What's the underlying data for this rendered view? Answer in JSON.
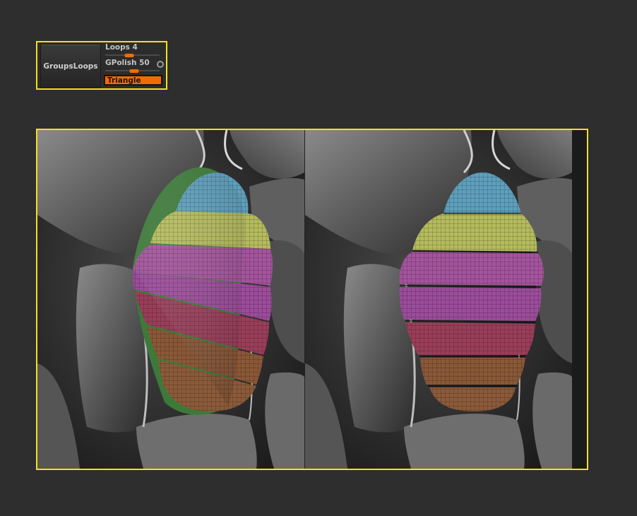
{
  "groups_loops": {
    "button_label": "GroupsLoops",
    "loops_label": "Loops 4",
    "loops_value": 4,
    "gpolish_label": "GPolish 50",
    "gpolish_value": 50,
    "triangle_label": "Triangle"
  },
  "colors": {
    "highlight": "#f2e21a",
    "accent": "#f06c00",
    "polygroups": [
      "#5e9fbc",
      "#b4bb5c",
      "#a3549c",
      "#9b4c9a",
      "#9a3e5a",
      "#8a5838",
      "#8b5a3a"
    ]
  }
}
